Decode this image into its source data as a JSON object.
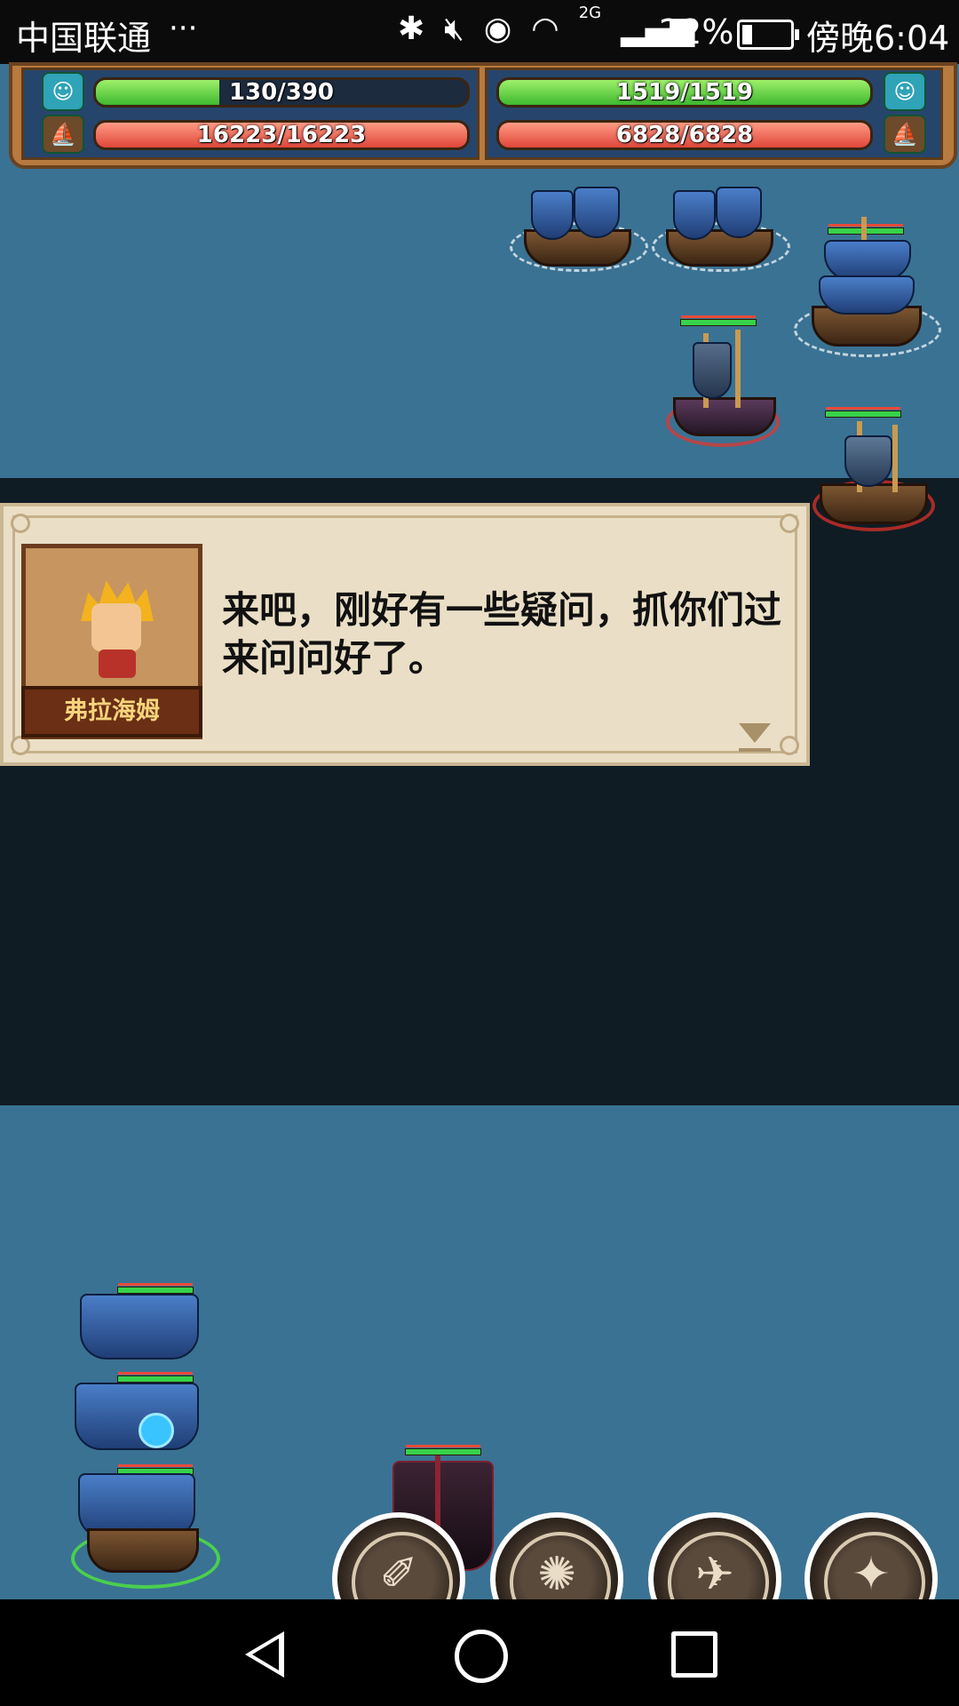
{
  "status_bar": {
    "carrier": "中国联通",
    "more": "···",
    "icons": [
      "bluetooth-icon",
      "mute-icon",
      "eye-icon",
      "wifi-icon",
      "signal-2g-icon"
    ],
    "network": "2G",
    "battery_percent": "22%",
    "battery_level": 0.22,
    "time": "傍晚6:04"
  },
  "hud": {
    "player": {
      "crew_text": "130/390",
      "crew_fraction": 0.333,
      "hull_text": "16223/16223",
      "hull_fraction": 1.0
    },
    "enemy": {
      "crew_text": "1519/1519",
      "crew_fraction": 1.0,
      "hull_text": "6828/6828",
      "hull_fraction": 1.0
    },
    "colors": {
      "crew": "#5cd63c",
      "hull": "#ec5a48",
      "frame": "#b87a3e",
      "panel": "#26456c"
    }
  },
  "dialog": {
    "speaker": "弗拉海姆",
    "text": "来吧，刚好有一些疑问，抓你们过来问问好了。",
    "continue_icon": "down-triangle-icon"
  },
  "skills": [
    {
      "name": "skill-1",
      "icon": "dash-icon"
    },
    {
      "name": "skill-2",
      "icon": "kraken-icon"
    },
    {
      "name": "skill-3",
      "icon": "bird-icon"
    },
    {
      "name": "skill-4",
      "icon": "star-burst-icon"
    }
  ],
  "nav": {
    "icons": [
      "back-icon",
      "home-icon",
      "recent-apps-icon"
    ]
  },
  "colors": {
    "sea": "#3a7293",
    "overlay": "#0f1c24",
    "dialog_bg": "#eadfc6"
  }
}
